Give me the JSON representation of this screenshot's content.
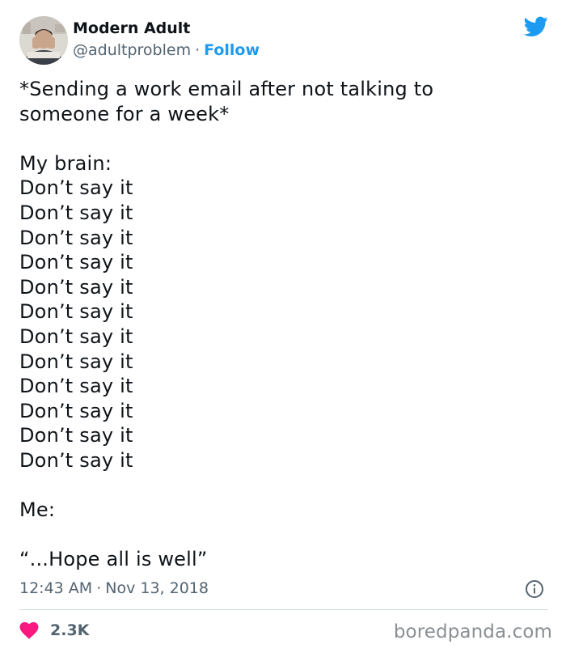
{
  "author": {
    "name": "Modern Adult",
    "handle": "@adultproblem",
    "separator": "·",
    "follow_label": "Follow"
  },
  "icons": {
    "brand": "twitter-bird-icon",
    "like": "heart-icon",
    "info": "info-icon"
  },
  "colors": {
    "accent": "#1d9bf0",
    "heart": "#f91880",
    "muted": "#536471"
  },
  "tweet": {
    "lines": [
      "*Sending a work email after not talking to",
      "someone for a week*",
      "",
      "My brain:",
      "Don’t say it",
      "Don’t say it",
      "Don’t say it",
      "Don’t say it",
      "Don’t say it",
      "Don’t say it",
      "Don’t say it",
      "Don’t say it",
      "Don’t say it",
      "Don’t say it",
      "Don’t say it",
      "Don’t say it",
      "",
      "Me:",
      "",
      "“...Hope all is well”"
    ],
    "time": "12:43 AM",
    "separator": "·",
    "date": "Nov 13, 2018",
    "likes": "2.3K"
  },
  "watermark": "boredpanda.com"
}
